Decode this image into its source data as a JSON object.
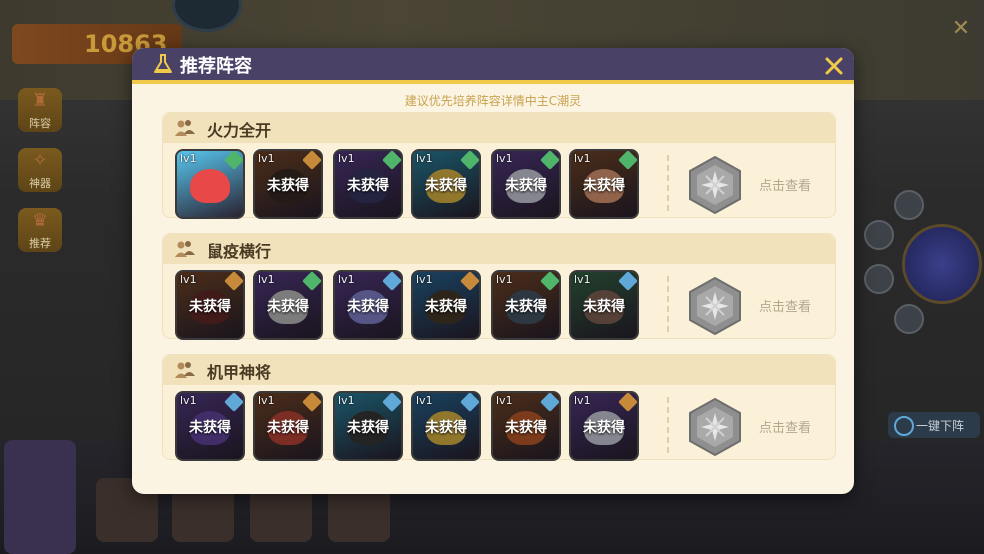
{
  "background": {
    "score": "10863",
    "side_menu": [
      {
        "label": "阵容",
        "icon": "lineup-icon"
      },
      {
        "label": "神器",
        "icon": "artifact-icon"
      },
      {
        "label": "推荐",
        "icon": "recommend-icon"
      }
    ],
    "quick_down_label": "一键下阵"
  },
  "modal": {
    "title": "推荐阵容",
    "subtitle": "建议优先培养阵容详情中主C潮灵",
    "view_label": "点击查看",
    "locked_label": "未获得",
    "level_label": "lv1",
    "sections": [
      {
        "title": "火力全开",
        "heroes": [
          {
            "level": "lv1",
            "locked": false,
            "frame": "#58c7f0",
            "tint": "#e84848",
            "element": "#4fb56a"
          },
          {
            "level": "lv1",
            "locked": true,
            "frame": "#7a4a2a",
            "tint": "#3a2a24",
            "element": "#c78a3a"
          },
          {
            "level": "lv1",
            "locked": true,
            "frame": "#5a3e8a",
            "tint": "#3a3a6a",
            "element": "#4fb56a"
          },
          {
            "level": "lv1",
            "locked": true,
            "frame": "#2a8aa8",
            "tint": "#e8c048",
            "element": "#4fb56a"
          },
          {
            "level": "lv1",
            "locked": true,
            "frame": "#5a3e8a",
            "tint": "#d8d8e8",
            "element": "#4fb56a"
          },
          {
            "level": "lv1",
            "locked": true,
            "frame": "#7a4a2a",
            "tint": "#e8a078",
            "element": "#4fb56a"
          }
        ]
      },
      {
        "title": "鼠疫横行",
        "heroes": [
          {
            "level": "lv1",
            "locked": true,
            "frame": "#7a4a2a",
            "tint": "#6a2a2a",
            "element": "#c78a3a"
          },
          {
            "level": "lv1",
            "locked": true,
            "frame": "#5a3e8a",
            "tint": "#c8c8c8",
            "element": "#4fb56a"
          },
          {
            "level": "lv1",
            "locked": true,
            "frame": "#5a3e8a",
            "tint": "#8a8ad8",
            "element": "#5fa8d8"
          },
          {
            "level": "lv1",
            "locked": true,
            "frame": "#2a6a9a",
            "tint": "#4a3a2a",
            "element": "#c78a3a"
          },
          {
            "level": "lv1",
            "locked": true,
            "frame": "#7a4a2a",
            "tint": "#4a5a6a",
            "element": "#4fb56a"
          },
          {
            "level": "lv1",
            "locked": true,
            "frame": "#3a6a4a",
            "tint": "#8a6a5a",
            "element": "#5fa8d8"
          }
        ]
      },
      {
        "title": "机甲神将",
        "heroes": [
          {
            "level": "lv1",
            "locked": true,
            "frame": "#5a3e8a",
            "tint": "#6a4aa8",
            "element": "#5fa8d8"
          },
          {
            "level": "lv1",
            "locked": true,
            "frame": "#7a4a2a",
            "tint": "#c84a3a",
            "element": "#c78a3a"
          },
          {
            "level": "lv1",
            "locked": true,
            "frame": "#2a8aa8",
            "tint": "#3a3a3a",
            "element": "#5fa8d8"
          },
          {
            "level": "lv1",
            "locked": true,
            "frame": "#2a6a9a",
            "tint": "#e8c048",
            "element": "#5fa8d8"
          },
          {
            "level": "lv1",
            "locked": true,
            "frame": "#7a4a2a",
            "tint": "#c8602a",
            "element": "#5fa8d8"
          },
          {
            "level": "lv1",
            "locked": true,
            "frame": "#5a3e8a",
            "tint": "#d8d8e8",
            "element": "#c78a3a"
          }
        ]
      }
    ]
  }
}
